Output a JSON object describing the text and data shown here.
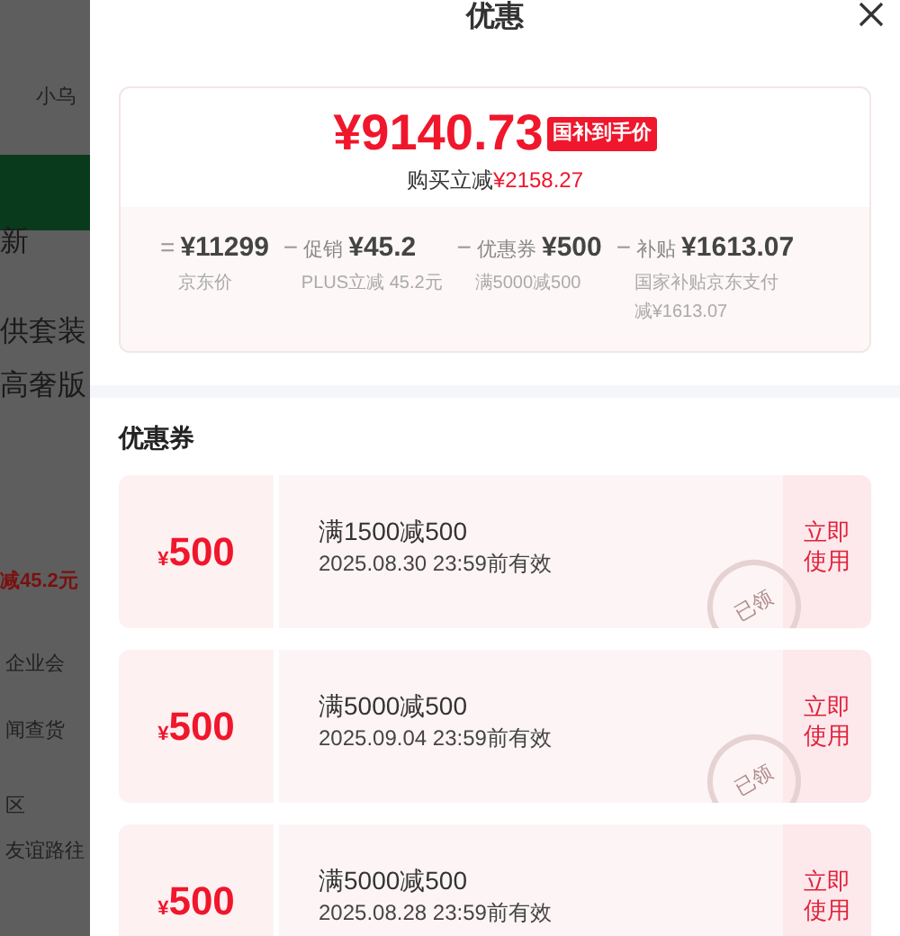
{
  "background_page": {
    "fragments": [
      "小乌",
      "新",
      "供套装",
      "高奢版",
      "减45.2元",
      "企业会",
      "闻查货",
      "区",
      "友谊路往"
    ]
  },
  "sheet": {
    "title": "优惠",
    "price_card": {
      "final_price": "¥9140.73",
      "badge": "国补到手价",
      "saving_label": "购买立减",
      "saving_amount": "¥2158.27",
      "breakdown": [
        {
          "op": "=",
          "amount": "¥11299",
          "note": "京东价"
        },
        {
          "op": "−",
          "label": "促销",
          "amount": "¥45.2",
          "note": "PLUS立减 45.2元"
        },
        {
          "op": "−",
          "label": "优惠券",
          "amount": "¥500",
          "note": "满5000减500"
        },
        {
          "op": "−",
          "label": "补贴",
          "amount": "¥1613.07",
          "note": "国家补贴京东支付减¥1613.07"
        }
      ]
    },
    "coupons_title": "优惠券",
    "coupons": [
      {
        "currency": "¥",
        "value": "500",
        "condition": "满1500减500",
        "expiry": "2025.08.30 23:59前有效",
        "stamp": "已领",
        "action": "立即使用"
      },
      {
        "currency": "¥",
        "value": "500",
        "condition": "满5000减500",
        "expiry": "2025.09.04 23:59前有效",
        "stamp": "已领",
        "action": "立即使用"
      },
      {
        "currency": "¥",
        "value": "500",
        "condition": "满5000减500",
        "expiry": "2025.08.28 23:59前有效",
        "action": "立即使用"
      }
    ]
  }
}
